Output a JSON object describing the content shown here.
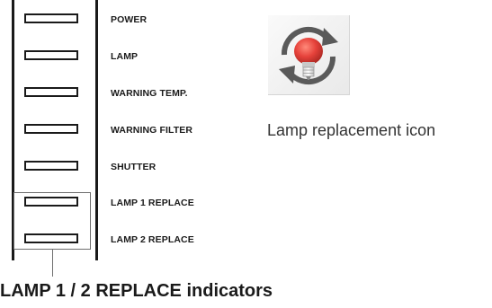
{
  "indicators": [
    {
      "label": "POWER"
    },
    {
      "label": "LAMP"
    },
    {
      "label": "WARNING TEMP."
    },
    {
      "label": "WARNING FILTER"
    },
    {
      "label": "SHUTTER"
    },
    {
      "label": "LAMP 1 REPLACE"
    },
    {
      "label": "LAMP 2 REPLACE"
    }
  ],
  "caption": "LAMP 1 / 2 REPLACE indicators",
  "icon": {
    "name": "lamp-replacement-icon",
    "caption": "Lamp replacement icon",
    "colors": {
      "bulb": "#e6423b",
      "arrows": "#5a5a5a"
    }
  }
}
